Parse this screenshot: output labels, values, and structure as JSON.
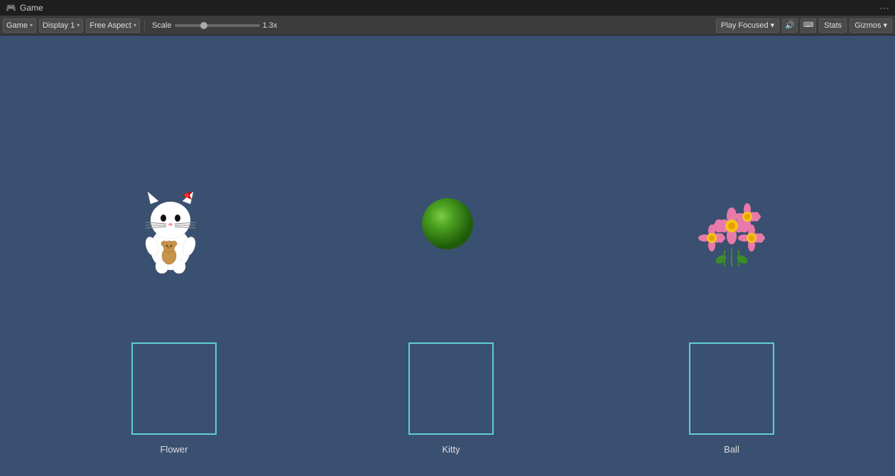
{
  "titlebar": {
    "icon": "🎮",
    "label": "Game",
    "dots_label": "⋯"
  },
  "toolbar": {
    "game_label": "Game",
    "display_label": "Display 1",
    "aspect_label": "Free Aspect",
    "scale_label": "Scale",
    "scale_value": "1.3x",
    "play_focused_label": "Play Focused",
    "stats_label": "Stats",
    "gizmos_label": "Gizmos",
    "arrow": "▾"
  },
  "game": {
    "sprites": {
      "kitty_label": "Kitty",
      "ball_label": "Ball",
      "flower_label": "Flower"
    }
  }
}
